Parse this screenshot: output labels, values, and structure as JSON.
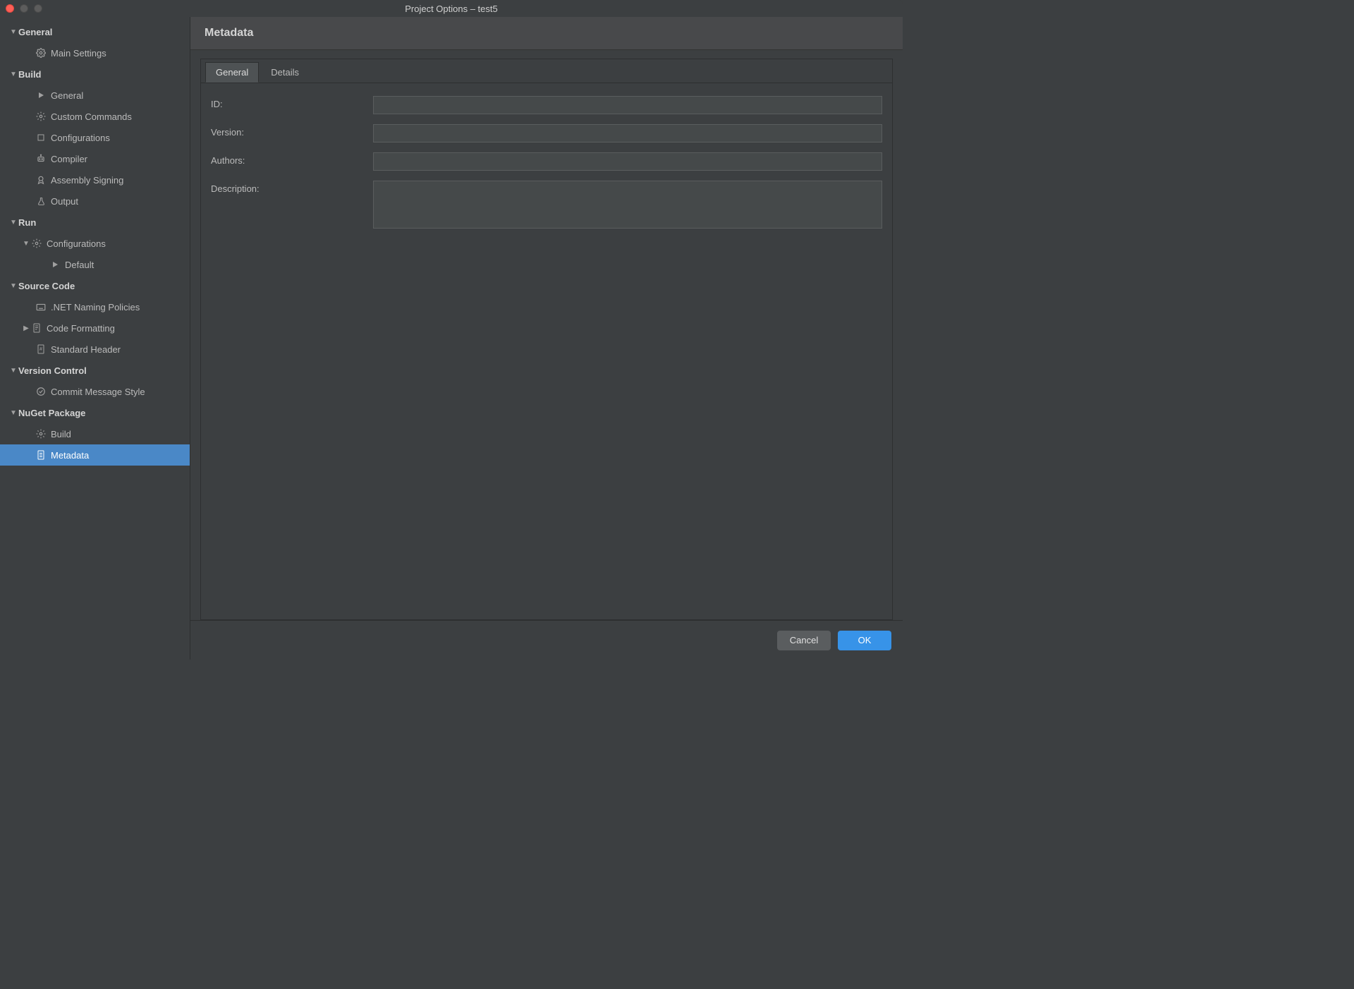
{
  "window": {
    "title": "Project Options – test5"
  },
  "sidebar": {
    "sections": [
      {
        "label": "General",
        "items": [
          {
            "label": "Main Settings",
            "icon": "gear-icon"
          }
        ]
      },
      {
        "label": "Build",
        "items": [
          {
            "label": "General",
            "icon": "play-icon"
          },
          {
            "label": "Custom Commands",
            "icon": "gear-icon"
          },
          {
            "label": "Configurations",
            "icon": "square-icon"
          },
          {
            "label": "Compiler",
            "icon": "robot-icon"
          },
          {
            "label": "Assembly Signing",
            "icon": "badge-icon"
          },
          {
            "label": "Output",
            "icon": "flask-icon"
          }
        ]
      },
      {
        "label": "Run",
        "items": [
          {
            "label": "Configurations",
            "icon": "gear-icon",
            "expanded": true,
            "children": [
              {
                "label": "Default",
                "icon": "play-icon"
              }
            ]
          }
        ]
      },
      {
        "label": "Source Code",
        "items": [
          {
            "label": ".NET Naming Policies",
            "icon": "keyboard-icon"
          },
          {
            "label": "Code Formatting",
            "icon": "doc-icon",
            "hasChildren": true
          },
          {
            "label": "Standard Header",
            "icon": "hash-icon"
          }
        ]
      },
      {
        "label": "Version Control",
        "items": [
          {
            "label": "Commit Message Style",
            "icon": "check-circle-icon"
          }
        ]
      },
      {
        "label": "NuGet Package",
        "items": [
          {
            "label": "Build",
            "icon": "gear-icon"
          },
          {
            "label": "Metadata",
            "icon": "page-icon",
            "selected": true
          }
        ]
      }
    ]
  },
  "main": {
    "title": "Metadata",
    "tabs": [
      {
        "label": "General",
        "active": true
      },
      {
        "label": "Details",
        "active": false
      }
    ],
    "form": {
      "id_label": "ID:",
      "id_value": "",
      "version_label": "Version:",
      "version_value": "",
      "authors_label": "Authors:",
      "authors_value": "",
      "description_label": "Description:",
      "description_value": ""
    }
  },
  "footer": {
    "cancel_label": "Cancel",
    "ok_label": "OK"
  }
}
